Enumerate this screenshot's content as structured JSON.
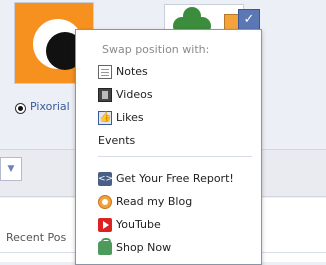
{
  "profile": {
    "app_name": "Pixorial"
  },
  "menu": {
    "title": "Swap position with:",
    "items": [
      {
        "label": "Notes",
        "icon": "notes-icon"
      },
      {
        "label": "Videos",
        "icon": "videos-icon"
      },
      {
        "label": "Likes",
        "icon": "likes-icon"
      },
      {
        "label": "Events",
        "icon": null
      }
    ],
    "apps": [
      {
        "label": "Get Your Free Report!",
        "icon": "report-icon"
      },
      {
        "label": "Read my Blog",
        "icon": "blog-icon"
      },
      {
        "label": "YouTube",
        "icon": "youtube-icon"
      },
      {
        "label": "Shop Now",
        "icon": "shop-icon"
      }
    ]
  },
  "page": {
    "recent_posts_label": "Recent Pos"
  },
  "colors": {
    "link": "#3b5998",
    "thumb_orange": "#f6901e",
    "youtube_red": "#dd2222"
  }
}
